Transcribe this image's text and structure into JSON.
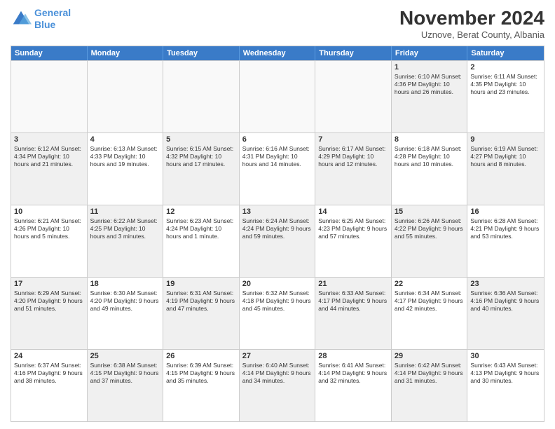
{
  "header": {
    "logo_line1": "General",
    "logo_line2": "Blue",
    "month_title": "November 2024",
    "location": "Uznove, Berat County, Albania"
  },
  "days_of_week": [
    "Sunday",
    "Monday",
    "Tuesday",
    "Wednesday",
    "Thursday",
    "Friday",
    "Saturday"
  ],
  "rows": [
    [
      {
        "num": "",
        "empty": true
      },
      {
        "num": "",
        "empty": true
      },
      {
        "num": "",
        "empty": true
      },
      {
        "num": "",
        "empty": true
      },
      {
        "num": "",
        "empty": true
      },
      {
        "num": "1",
        "info": "Sunrise: 6:10 AM\nSunset: 4:36 PM\nDaylight: 10 hours\nand 26 minutes.",
        "shaded": true
      },
      {
        "num": "2",
        "info": "Sunrise: 6:11 AM\nSunset: 4:35 PM\nDaylight: 10 hours\nand 23 minutes.",
        "shaded": false
      }
    ],
    [
      {
        "num": "3",
        "info": "Sunrise: 6:12 AM\nSunset: 4:34 PM\nDaylight: 10 hours\nand 21 minutes.",
        "shaded": true
      },
      {
        "num": "4",
        "info": "Sunrise: 6:13 AM\nSunset: 4:33 PM\nDaylight: 10 hours\nand 19 minutes.",
        "shaded": false
      },
      {
        "num": "5",
        "info": "Sunrise: 6:15 AM\nSunset: 4:32 PM\nDaylight: 10 hours\nand 17 minutes.",
        "shaded": true
      },
      {
        "num": "6",
        "info": "Sunrise: 6:16 AM\nSunset: 4:31 PM\nDaylight: 10 hours\nand 14 minutes.",
        "shaded": false
      },
      {
        "num": "7",
        "info": "Sunrise: 6:17 AM\nSunset: 4:29 PM\nDaylight: 10 hours\nand 12 minutes.",
        "shaded": true
      },
      {
        "num": "8",
        "info": "Sunrise: 6:18 AM\nSunset: 4:28 PM\nDaylight: 10 hours\nand 10 minutes.",
        "shaded": false
      },
      {
        "num": "9",
        "info": "Sunrise: 6:19 AM\nSunset: 4:27 PM\nDaylight: 10 hours\nand 8 minutes.",
        "shaded": true
      }
    ],
    [
      {
        "num": "10",
        "info": "Sunrise: 6:21 AM\nSunset: 4:26 PM\nDaylight: 10 hours\nand 5 minutes.",
        "shaded": false
      },
      {
        "num": "11",
        "info": "Sunrise: 6:22 AM\nSunset: 4:25 PM\nDaylight: 10 hours\nand 3 minutes.",
        "shaded": true
      },
      {
        "num": "12",
        "info": "Sunrise: 6:23 AM\nSunset: 4:24 PM\nDaylight: 10 hours\nand 1 minute.",
        "shaded": false
      },
      {
        "num": "13",
        "info": "Sunrise: 6:24 AM\nSunset: 4:24 PM\nDaylight: 9 hours\nand 59 minutes.",
        "shaded": true
      },
      {
        "num": "14",
        "info": "Sunrise: 6:25 AM\nSunset: 4:23 PM\nDaylight: 9 hours\nand 57 minutes.",
        "shaded": false
      },
      {
        "num": "15",
        "info": "Sunrise: 6:26 AM\nSunset: 4:22 PM\nDaylight: 9 hours\nand 55 minutes.",
        "shaded": true
      },
      {
        "num": "16",
        "info": "Sunrise: 6:28 AM\nSunset: 4:21 PM\nDaylight: 9 hours\nand 53 minutes.",
        "shaded": false
      }
    ],
    [
      {
        "num": "17",
        "info": "Sunrise: 6:29 AM\nSunset: 4:20 PM\nDaylight: 9 hours\nand 51 minutes.",
        "shaded": true
      },
      {
        "num": "18",
        "info": "Sunrise: 6:30 AM\nSunset: 4:20 PM\nDaylight: 9 hours\nand 49 minutes.",
        "shaded": false
      },
      {
        "num": "19",
        "info": "Sunrise: 6:31 AM\nSunset: 4:19 PM\nDaylight: 9 hours\nand 47 minutes.",
        "shaded": true
      },
      {
        "num": "20",
        "info": "Sunrise: 6:32 AM\nSunset: 4:18 PM\nDaylight: 9 hours\nand 45 minutes.",
        "shaded": false
      },
      {
        "num": "21",
        "info": "Sunrise: 6:33 AM\nSunset: 4:17 PM\nDaylight: 9 hours\nand 44 minutes.",
        "shaded": true
      },
      {
        "num": "22",
        "info": "Sunrise: 6:34 AM\nSunset: 4:17 PM\nDaylight: 9 hours\nand 42 minutes.",
        "shaded": false
      },
      {
        "num": "23",
        "info": "Sunrise: 6:36 AM\nSunset: 4:16 PM\nDaylight: 9 hours\nand 40 minutes.",
        "shaded": true
      }
    ],
    [
      {
        "num": "24",
        "info": "Sunrise: 6:37 AM\nSunset: 4:16 PM\nDaylight: 9 hours\nand 38 minutes.",
        "shaded": false
      },
      {
        "num": "25",
        "info": "Sunrise: 6:38 AM\nSunset: 4:15 PM\nDaylight: 9 hours\nand 37 minutes.",
        "shaded": true
      },
      {
        "num": "26",
        "info": "Sunrise: 6:39 AM\nSunset: 4:15 PM\nDaylight: 9 hours\nand 35 minutes.",
        "shaded": false
      },
      {
        "num": "27",
        "info": "Sunrise: 6:40 AM\nSunset: 4:14 PM\nDaylight: 9 hours\nand 34 minutes.",
        "shaded": true
      },
      {
        "num": "28",
        "info": "Sunrise: 6:41 AM\nSunset: 4:14 PM\nDaylight: 9 hours\nand 32 minutes.",
        "shaded": false
      },
      {
        "num": "29",
        "info": "Sunrise: 6:42 AM\nSunset: 4:14 PM\nDaylight: 9 hours\nand 31 minutes.",
        "shaded": true
      },
      {
        "num": "30",
        "info": "Sunrise: 6:43 AM\nSunset: 4:13 PM\nDaylight: 9 hours\nand 30 minutes.",
        "shaded": false
      }
    ]
  ]
}
